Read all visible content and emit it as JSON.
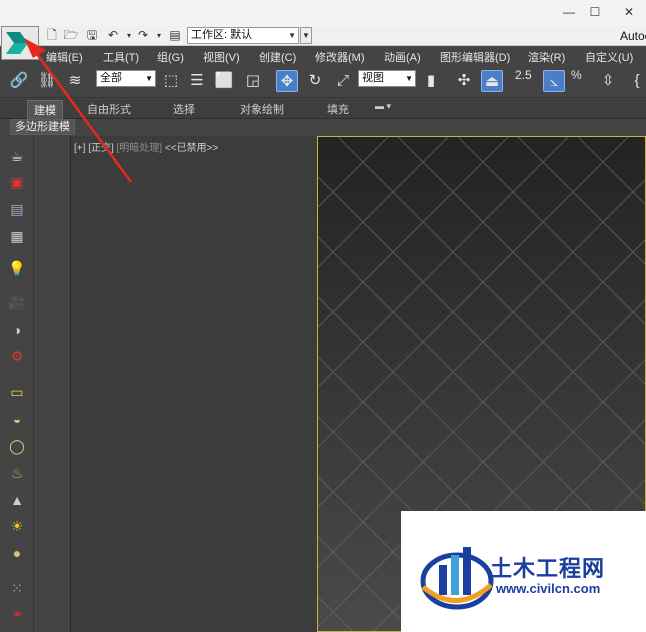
{
  "titlebar": {
    "minimize": "—",
    "maximize": "☐",
    "close": "✕"
  },
  "quickaccess": {
    "workspace_value": "工作区: 默认",
    "app_title": "Autoc"
  },
  "menubar": {
    "items": [
      "编辑(E)",
      "工具(T)",
      "组(G)",
      "视图(V)",
      "创建(C)",
      "修改器(M)",
      "动画(A)",
      "图形编辑器(D)",
      "渲染(R)",
      "自定义(U)"
    ]
  },
  "toolbar": {
    "selection_filter": "全部",
    "reference_coord": "视图",
    "snap_label": "2.5",
    "percent_snap": "%"
  },
  "ribbon": {
    "tabs": [
      "建模",
      "自由形式",
      "选择",
      "对象绘制",
      "填充"
    ],
    "subtab": "多边形建模"
  },
  "viewport": {
    "label_plus": "[+]",
    "label_view": "[正交]",
    "label_shading": "[明暗处理]",
    "label_disabled": "<<已禁用>>"
  },
  "watermark": {
    "name": "土木工程网",
    "url": "www.civilcn.com"
  },
  "colors": {
    "accent": "#4a7fc7",
    "viewport_border": "#c8b43a",
    "annotation": "#e8281e"
  }
}
